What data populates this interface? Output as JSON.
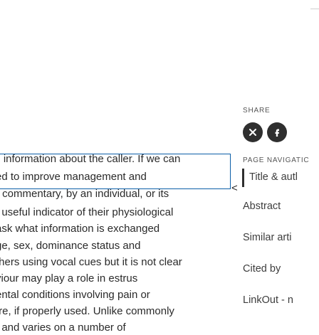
{
  "article": {
    "lines": [
      "il information about the caller. If we can",
      "ed to improve management and",
      "· commentary, by an individual, or its",
      "; useful indicator of their physiological",
      "ask what information is exchanged",
      "ge, sex, dominance status and",
      "thers using vocal cues but it is not clear",
      "viour may play a role in estrus",
      "ental conditions involving pain or",
      "ıre, if properly used. Unlike commonly",
      "/ and varies on a number of"
    ]
  },
  "sidebar": {
    "share_label": "SHARE",
    "share_icons": [
      "share-icon-1",
      "share-icon-2"
    ],
    "nav_label": "PAGE NAVIGATIC",
    "nav_items": [
      "Title & autl",
      "Abstract",
      "Similar arti",
      "Cited by",
      "LinkOut - n"
    ]
  },
  "overlay": {
    "caret": "<"
  },
  "colors": {
    "accent": "#0b5ea8",
    "icon_fill": "#2f2f2f"
  }
}
